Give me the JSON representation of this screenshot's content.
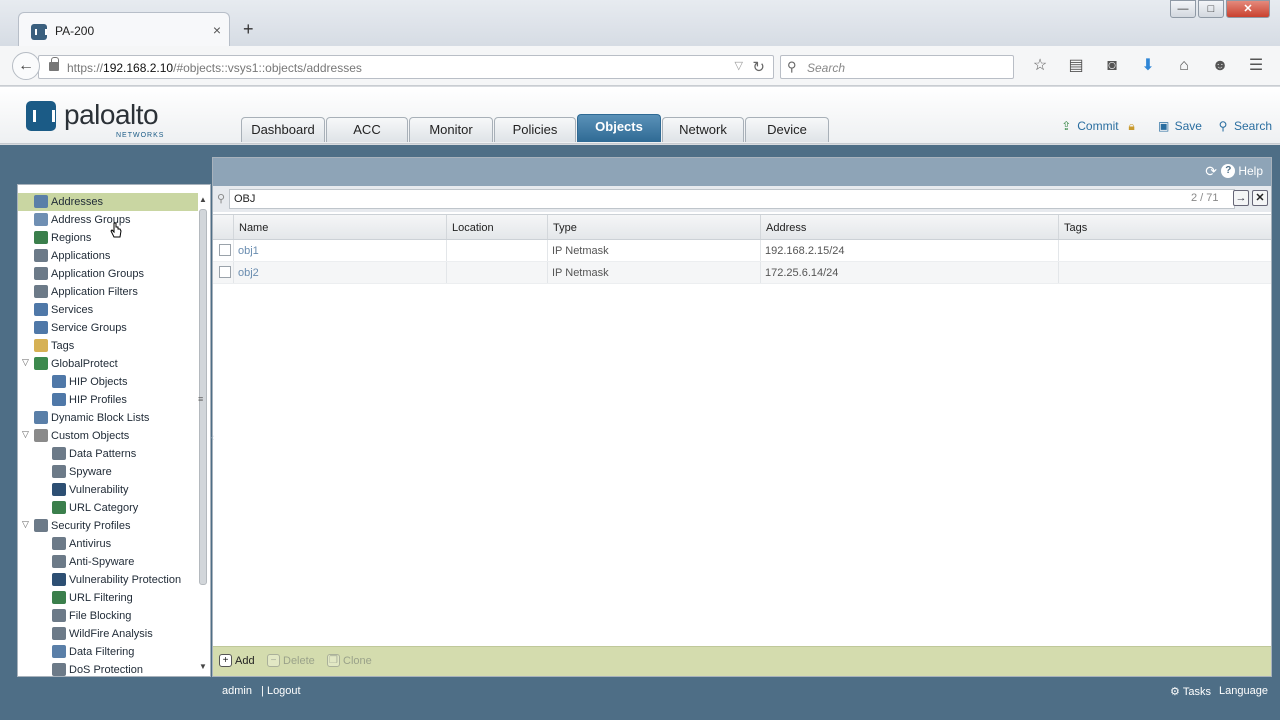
{
  "browser": {
    "tab_title": "PA-200",
    "tab_close": "×",
    "new_tab": "+",
    "window_controls": {
      "minimize": "—",
      "maximize": "□",
      "close": "✕"
    },
    "url_prefix": "https://",
    "url_host": "192.168.2.10",
    "url_path": "/#objects::vsys1::objects/addresses",
    "search_placeholder": "Search",
    "toolbar_icons": [
      "star-icon",
      "reading-list-icon",
      "pocket-icon",
      "download-icon",
      "home-icon",
      "chat-icon",
      "menu-icon"
    ]
  },
  "app": {
    "logo_text": "paloalto",
    "logo_sub": "NETWORKS",
    "tabs": [
      {
        "label": "Dashboard",
        "active": false
      },
      {
        "label": "ACC",
        "active": false
      },
      {
        "label": "Monitor",
        "active": false
      },
      {
        "label": "Policies",
        "active": false
      },
      {
        "label": "Objects",
        "active": true
      },
      {
        "label": "Network",
        "active": false
      },
      {
        "label": "Device",
        "active": false
      }
    ],
    "actions": {
      "commit": "Commit",
      "save": "Save",
      "search": "Search"
    }
  },
  "sidebar": {
    "items": [
      {
        "label": "Addresses",
        "indent": 0,
        "selected": true,
        "icon": "address-icon",
        "color": "#5a7fa8"
      },
      {
        "label": "Address Groups",
        "indent": 0,
        "icon": "address-group-icon",
        "color": "#6f8fb3"
      },
      {
        "label": "Regions",
        "indent": 0,
        "icon": "globe-icon",
        "color": "#3b7f4c"
      },
      {
        "label": "Applications",
        "indent": 0,
        "icon": "grid-icon",
        "color": "#6c7a88"
      },
      {
        "label": "Application Groups",
        "indent": 0,
        "icon": "grid-icon",
        "color": "#6c7a88"
      },
      {
        "label": "Application Filters",
        "indent": 0,
        "icon": "grid-icon",
        "color": "#6c7a88"
      },
      {
        "label": "Services",
        "indent": 0,
        "icon": "tools-icon",
        "color": "#4f78a8"
      },
      {
        "label": "Service Groups",
        "indent": 0,
        "icon": "tools-icon",
        "color": "#4f78a8"
      },
      {
        "label": "Tags",
        "indent": 0,
        "icon": "tag-icon",
        "color": "#d6b154"
      },
      {
        "label": "GlobalProtect",
        "indent": 0,
        "expanded": true,
        "icon": "globalprotect-icon",
        "color": "#3d8a4e"
      },
      {
        "label": "HIP Objects",
        "indent": 1,
        "icon": "monitor-icon",
        "color": "#4f78a8"
      },
      {
        "label": "HIP Profiles",
        "indent": 1,
        "icon": "monitor-icon",
        "color": "#4f78a8"
      },
      {
        "label": "Dynamic Block Lists",
        "indent": 0,
        "icon": "list-icon",
        "color": "#5a7fa8"
      },
      {
        "label": "Custom Objects",
        "indent": 0,
        "expanded": true,
        "icon": "custom-objects-icon",
        "color": "#8a8a8a"
      },
      {
        "label": "Data Patterns",
        "indent": 1,
        "icon": "document-icon",
        "color": "#6c7a88"
      },
      {
        "label": "Spyware",
        "indent": 1,
        "icon": "spyware-icon",
        "color": "#6c7a88"
      },
      {
        "label": "Vulnerability",
        "indent": 1,
        "icon": "shield-icon",
        "color": "#2d4f73"
      },
      {
        "label": "URL Category",
        "indent": 1,
        "icon": "globe-icon",
        "color": "#3b7f4c"
      },
      {
        "label": "Security Profiles",
        "indent": 0,
        "expanded": true,
        "icon": "security-profiles-icon",
        "color": "#6c7a88"
      },
      {
        "label": "Antivirus",
        "indent": 1,
        "icon": "antivirus-icon",
        "color": "#6c7a88"
      },
      {
        "label": "Anti-Spyware",
        "indent": 1,
        "icon": "spyware-icon",
        "color": "#6c7a88"
      },
      {
        "label": "Vulnerability Protection",
        "indent": 1,
        "icon": "shield-icon",
        "color": "#2d4f73"
      },
      {
        "label": "URL Filtering",
        "indent": 1,
        "icon": "globe-icon",
        "color": "#3b7f4c"
      },
      {
        "label": "File Blocking",
        "indent": 1,
        "icon": "document-icon",
        "color": "#6c7a88"
      },
      {
        "label": "WildFire Analysis",
        "indent": 1,
        "icon": "wildfire-icon",
        "color": "#6c7a88"
      },
      {
        "label": "Data Filtering",
        "indent": 1,
        "icon": "filter-icon",
        "color": "#5a7fa8"
      },
      {
        "label": "DoS Protection",
        "indent": 1,
        "icon": "dos-icon",
        "color": "#6c7a88"
      }
    ]
  },
  "panel": {
    "help": "Help",
    "filter_value": "OBJ",
    "count": "2 / 71",
    "columns": [
      "Name",
      "Location",
      "Type",
      "Address",
      "Tags"
    ],
    "rows": [
      {
        "name": "obj1",
        "location": "",
        "type": "IP Netmask",
        "address": "192.168.2.15/24",
        "tags": ""
      },
      {
        "name": "obj2",
        "location": "",
        "type": "IP Netmask",
        "address": "172.25.6.14/24",
        "tags": ""
      }
    ],
    "buttons": {
      "add": "Add",
      "delete": "Delete",
      "clone": "Clone"
    }
  },
  "status": {
    "user": "admin",
    "logout": "| Logout",
    "tasks": "Tasks",
    "language": "Language"
  }
}
